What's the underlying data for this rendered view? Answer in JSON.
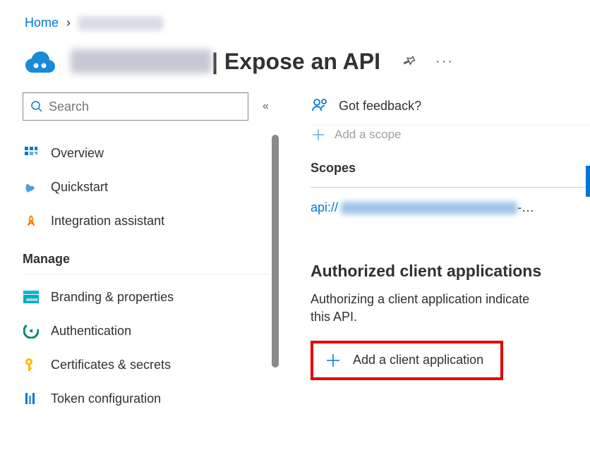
{
  "breadcrumb": {
    "home": "Home"
  },
  "header": {
    "title_suffix": " | Expose an API"
  },
  "sidebar": {
    "search_placeholder": "Search",
    "items": {
      "overview": "Overview",
      "quickstart": "Quickstart",
      "integration": "Integration assistant"
    },
    "manage_header": "Manage",
    "manage_items": {
      "branding": "Branding & properties",
      "authentication": "Authentication",
      "certificates": "Certificates & secrets",
      "token": "Token configuration"
    }
  },
  "main": {
    "feedback": "Got feedback?",
    "add_scope": "Add a scope",
    "scopes_label": "Scopes",
    "scope_prefix": "api://",
    "scope_suffix": "-…",
    "authorized_title": "Authorized client applications",
    "authorized_desc_line1": "Authorizing a client application indicate",
    "authorized_desc_line2": "this API.",
    "add_client": "Add a client application"
  }
}
